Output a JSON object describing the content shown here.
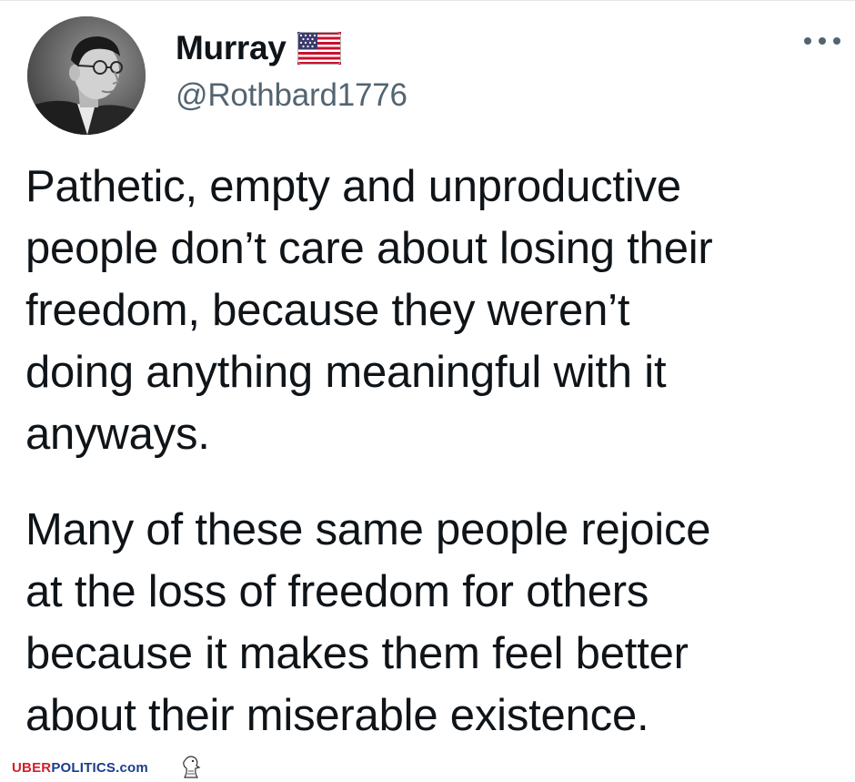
{
  "tweet": {
    "display_name": "Murray",
    "flag_icon": "us-flag-icon",
    "handle": "@Rothbard1776",
    "more_icon": "more-options-icon",
    "paragraph_1": "Pathetic, empty and unproductive\npeople don’t care about losing their\nfreedom, because they weren’t\ndoing anything meaningful with it\nanyways.",
    "paragraph_2": "Many of these same people rejoice\nat the loss of freedom for others\nbecause it makes them feel better\nabout their miserable existence."
  },
  "watermark": {
    "part_red": "UBER",
    "part_blue": "POLITICS.com",
    "logo_icon": "eagle-logo-icon"
  },
  "colors": {
    "text": "#0f1419",
    "secondary": "#536471",
    "watermark_red": "#d11f2a",
    "watermark_blue": "#1b3c8c"
  }
}
